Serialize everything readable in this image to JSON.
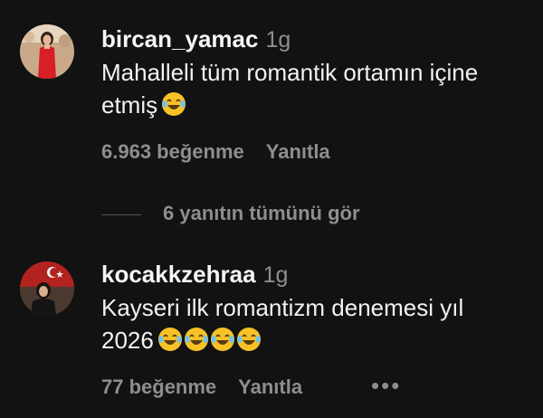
{
  "comments": [
    {
      "username": "bircan_yamac",
      "time": "1g",
      "text_line1": "Mahalleli tüm romantik ortamın içine",
      "text_line2": "etmiş",
      "emoji_count": 1,
      "likes": "6.963 beğenme",
      "reply_label": "Yanıtla",
      "avatar_icon": "woman-red-dress-avatar"
    },
    {
      "username": "kocakkzehraa",
      "time": "1g",
      "text_line1": "Kayseri ilk romantizm denemesi yıl",
      "text_line2": "2026",
      "emoji_count": 4,
      "likes": "77 beğenme",
      "reply_label": "Yanıtla",
      "avatar_icon": "woman-turkish-flag-avatar"
    }
  ],
  "view_replies": "6 yanıtın tümünü gör",
  "more_label": "•••",
  "colors": {
    "background": "#121212",
    "primary_text": "#f5f5f5",
    "secondary_text": "#8e8e8e",
    "emoji_yellow": "#f7c227"
  }
}
